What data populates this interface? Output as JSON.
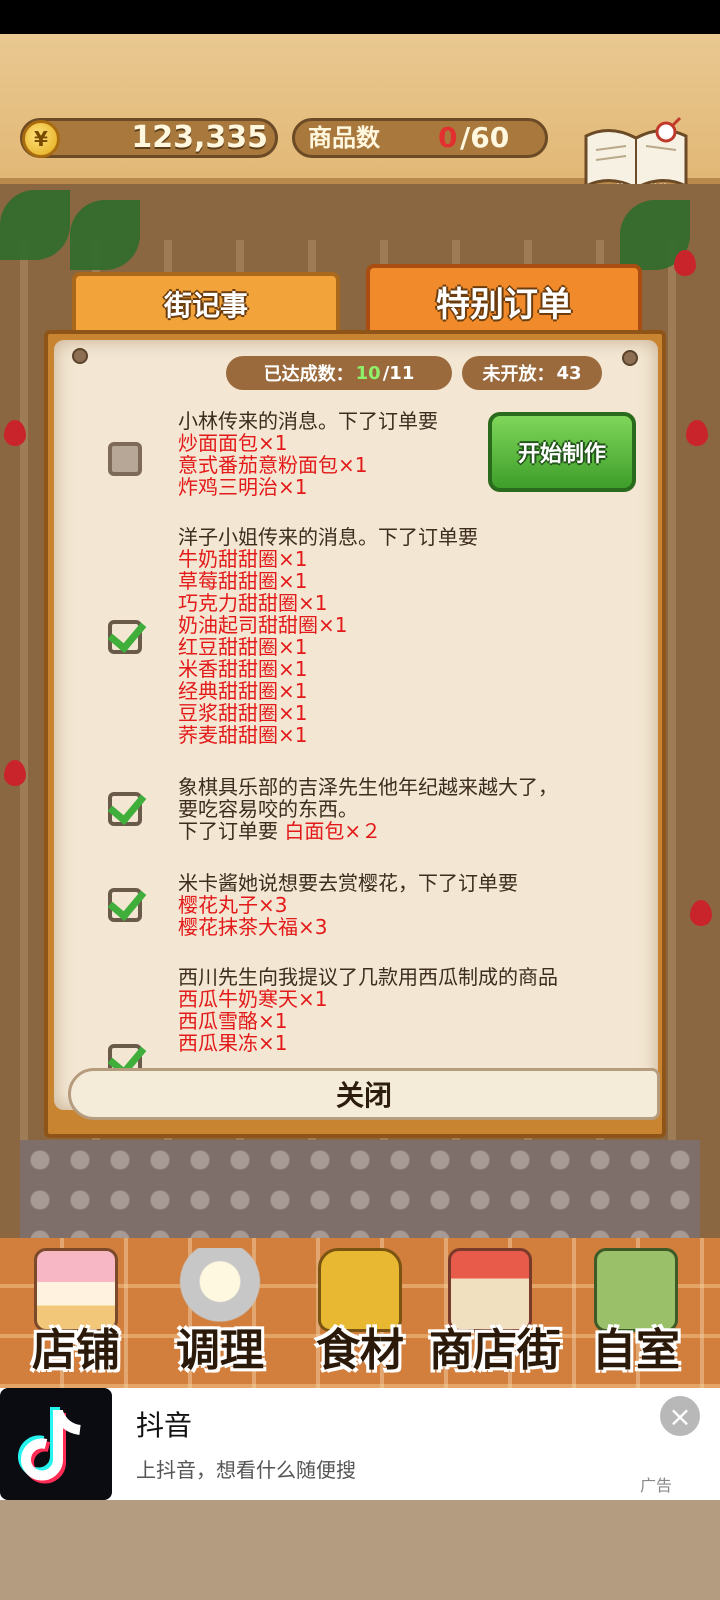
{
  "header": {
    "money": "123,335",
    "coin_symbol": "¥",
    "product_count_label": "商品数",
    "product_count_current": "0",
    "product_count_max": "/60",
    "recipe_label": "食谱"
  },
  "tabs": [
    {
      "label": "街记事",
      "active": false
    },
    {
      "label": "特别订单",
      "active": true
    }
  ],
  "panel": {
    "achieved_label": "已达成数：",
    "achieved_current": "10",
    "achieved_total": "/11",
    "unopened_label": "未开放：",
    "unopened_value": "43",
    "start_button": "开始制作",
    "close_button": "关闭",
    "orders": [
      {
        "checked": false,
        "lines": [
          {
            "text": "小林传来的消息。下了订单要",
            "type": "desc"
          },
          {
            "text": "炒面面包×1",
            "type": "item"
          },
          {
            "text": "意式番茄意粉面包×1",
            "type": "item"
          },
          {
            "text": "炸鸡三明治×1",
            "type": "item"
          }
        ]
      },
      {
        "checked": true,
        "lines": [
          {
            "text": "洋子小姐传来的消息。下了订单要",
            "type": "desc"
          },
          {
            "text": "牛奶甜甜圈×1",
            "type": "item"
          },
          {
            "text": "草莓甜甜圈×1",
            "type": "item"
          },
          {
            "text": "巧克力甜甜圈×1",
            "type": "item"
          },
          {
            "text": "奶油起司甜甜圈×1",
            "type": "item"
          },
          {
            "text": "红豆甜甜圈×1",
            "type": "item"
          },
          {
            "text": "米香甜甜圈×1",
            "type": "item"
          },
          {
            "text": "经典甜甜圈×1",
            "type": "item"
          },
          {
            "text": "豆浆甜甜圈×1",
            "type": "item"
          },
          {
            "text": "荞麦甜甜圈×1",
            "type": "item"
          }
        ]
      },
      {
        "checked": true,
        "lines": [
          {
            "text": "象棋具乐部的吉泽先生他年纪越来越大了，",
            "type": "desc"
          },
          {
            "text": "要吃容易咬的东西。",
            "type": "desc"
          },
          {
            "text": "下了订单要",
            "type": "desc",
            "inline_item": "白面包×２"
          }
        ]
      },
      {
        "checked": true,
        "lines": [
          {
            "text": "米卡酱她说想要去赏樱花，下了订单要",
            "type": "desc"
          },
          {
            "text": "樱花丸子×3",
            "type": "item"
          },
          {
            "text": "樱花抹茶大福×3",
            "type": "item"
          }
        ]
      },
      {
        "checked": true,
        "lines": [
          {
            "text": "西川先生向我提议了几款用西瓜制成的商品",
            "type": "desc"
          },
          {
            "text": "西瓜牛奶寒天×1",
            "type": "item"
          },
          {
            "text": "西瓜雪酪×1",
            "type": "item"
          },
          {
            "text": "西瓜果冻×1",
            "type": "item"
          }
        ]
      }
    ]
  },
  "bottom_nav": [
    {
      "label": "店铺",
      "icon": "cake-icon"
    },
    {
      "label": "调理",
      "icon": "mixing-bowl-icon"
    },
    {
      "label": "食材",
      "icon": "flour-sack-icon"
    },
    {
      "label": "商店街",
      "icon": "storefront-icon"
    },
    {
      "label": "自室",
      "icon": "staff-only-door-icon"
    }
  ],
  "ad": {
    "title": "抖音",
    "subtitle": "上抖音，想看什么随便搜",
    "tag": "广告",
    "close_symbol": "×"
  },
  "colors": {
    "accent_orange": "#f08a2a",
    "item_red": "#e31a1a",
    "check_green": "#3fae3a",
    "start_green": "#5cbf3e"
  }
}
